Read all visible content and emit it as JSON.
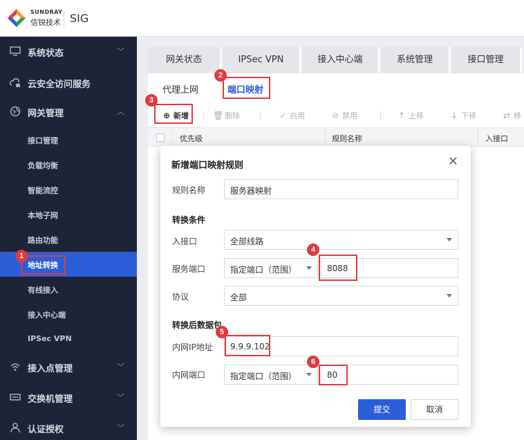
{
  "brand": {
    "en": "SUNDRAY",
    "cn": "信锐技术",
    "product": "SIG"
  },
  "sidebar": {
    "top_items": [
      {
        "label": "系统状态",
        "icon": "monitor-icon"
      },
      {
        "label": "云安全访问服务",
        "icon": "cloud-lock-icon"
      },
      {
        "label": "网关管理",
        "icon": "globe-icon"
      }
    ],
    "sub_items": [
      {
        "label": "接口管理"
      },
      {
        "label": "负载均衡"
      },
      {
        "label": "智能流控"
      },
      {
        "label": "本地子网"
      },
      {
        "label": "路由功能"
      },
      {
        "label": "地址转换",
        "active": true
      },
      {
        "label": "有线接入"
      },
      {
        "label": "接入中心端"
      },
      {
        "label": "IPSec VPN"
      }
    ],
    "bottom_items": [
      {
        "label": "接入点管理",
        "icon": "wifi-icon"
      },
      {
        "label": "交换机管理",
        "icon": "switch-icon"
      },
      {
        "label": "认证授权",
        "icon": "user-icon"
      }
    ]
  },
  "tabs": [
    "网关状态",
    "IPSec VPN",
    "接入中心端",
    "系统管理",
    "接口管理"
  ],
  "subtabs": [
    "代理上网",
    "端口映射"
  ],
  "toolbar": {
    "add": "新增",
    "delete": "删除",
    "enable": "启用",
    "disable": "禁用",
    "up": "上移",
    "down": "下移",
    "move": "移"
  },
  "table": {
    "headers": [
      "优先级",
      "规则名称",
      "入接口"
    ]
  },
  "modal": {
    "title": "新增端口映射规则",
    "rule_name_label": "规则名称",
    "rule_name_value": "服务器映射",
    "section_conditions": "转换条件",
    "in_iface_label": "入接口",
    "in_iface_value": "全部线路",
    "service_port_label": "服务端口",
    "service_port_mode": "指定端口（范围）",
    "service_port_value": "8088",
    "protocol_label": "协议",
    "protocol_value": "全部",
    "section_after": "转换后数据包",
    "inner_ip_label": "内网IP地址",
    "inner_ip_value": "9.9.9.102",
    "inner_port_label": "内网端口",
    "inner_port_mode": "指定端口（范围）",
    "inner_port_value": "80",
    "submit": "提交",
    "cancel": "取消"
  },
  "badges": [
    "1",
    "2",
    "3",
    "4",
    "5",
    "6"
  ],
  "colors": {
    "sidebar_bg": "#1e2437",
    "accent": "#2b5ed6",
    "highlight": "#e4393c"
  }
}
